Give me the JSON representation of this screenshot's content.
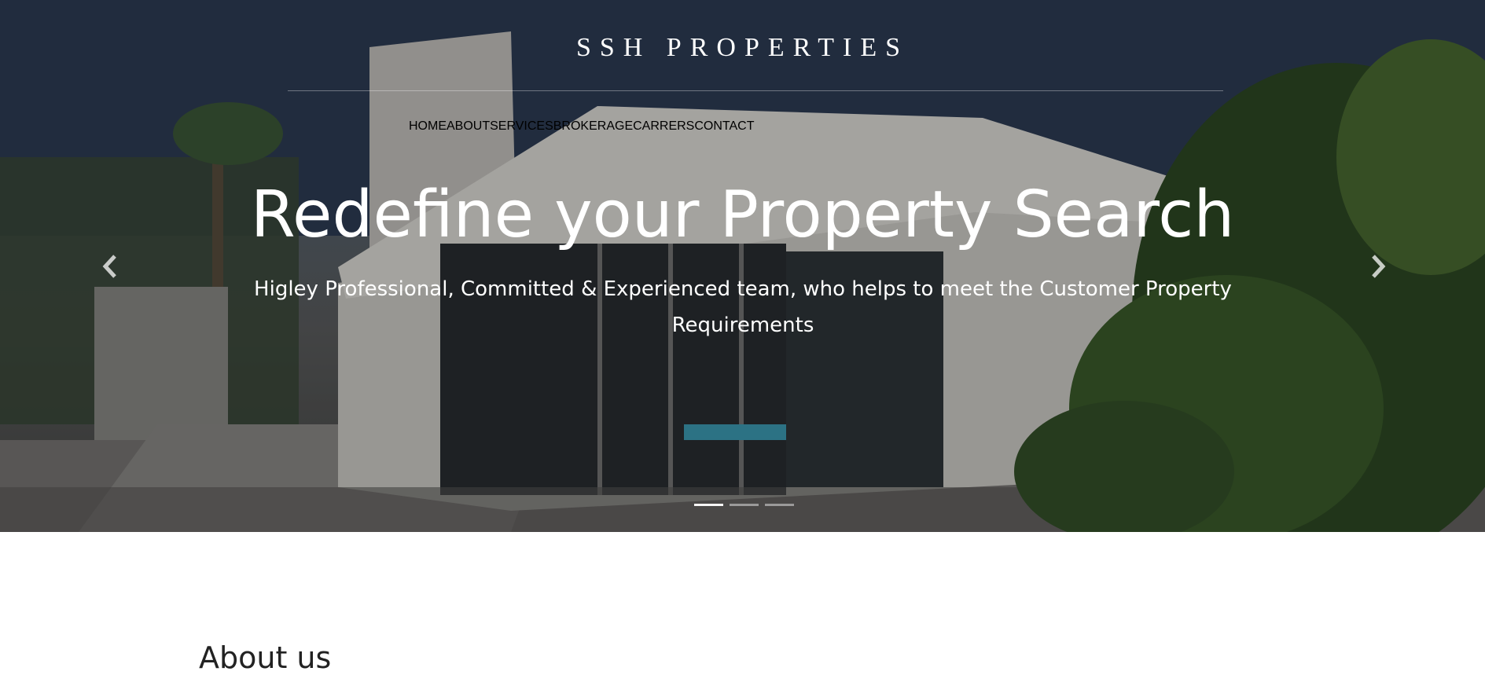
{
  "brand": {
    "name": "SSH  PROPERTIES"
  },
  "nav": {
    "items": [
      {
        "label": "HOME"
      },
      {
        "label": "ABOUT"
      },
      {
        "label": "SERVICES"
      },
      {
        "label": "BROKERAGE"
      },
      {
        "label": "CARRERS"
      },
      {
        "label": "CONTACT"
      }
    ]
  },
  "hero": {
    "title": "Redefine your Property Search",
    "subtitle": "Higley Professional, Committed & Experienced team, who helps to meet the Customer Property Requirements",
    "prev_icon": "chevron-left-icon",
    "next_icon": "chevron-right-icon",
    "slides_total": 3,
    "active_slide": 1
  },
  "about": {
    "heading": "About us"
  },
  "colors": {
    "text_light": "#ffffff",
    "heading_dark": "#222222"
  }
}
